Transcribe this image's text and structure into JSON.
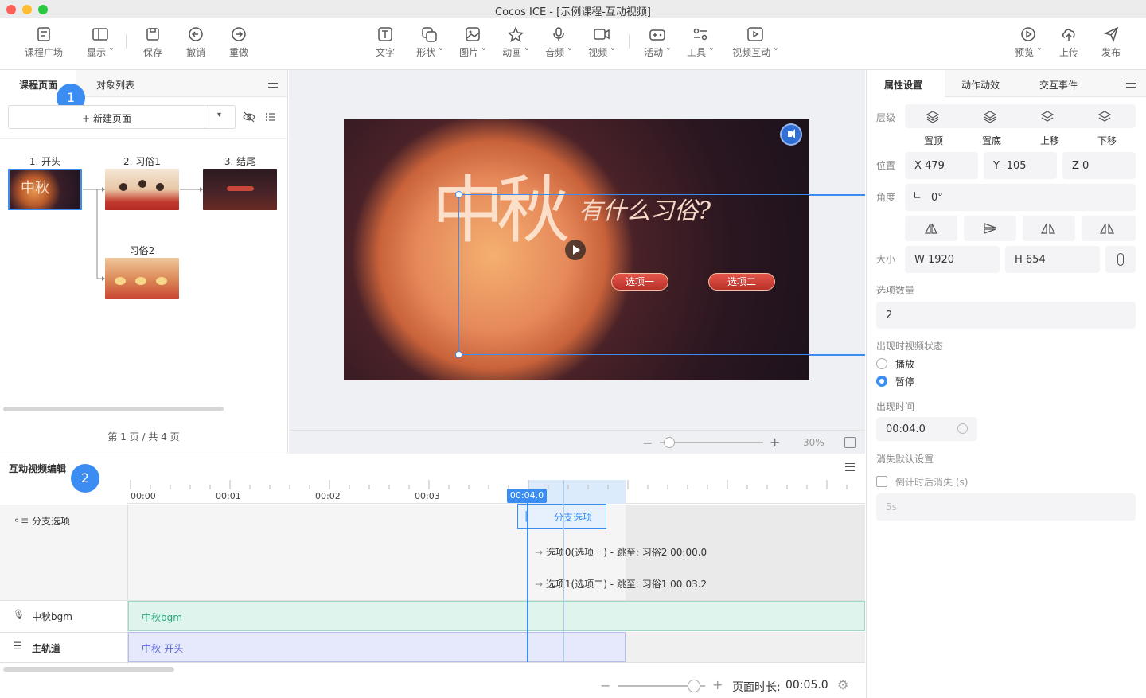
{
  "window": {
    "title": "Cocos ICE - [示例课程-互动视频]"
  },
  "toolbar": {
    "left": [
      {
        "label": "课程广场",
        "icon": "course-plaza-icon"
      },
      {
        "label": "显示",
        "icon": "display-icon"
      },
      {
        "label": "保存",
        "icon": "save-icon"
      },
      {
        "label": "撤销",
        "icon": "undo-icon"
      },
      {
        "label": "重做",
        "icon": "redo-icon"
      }
    ],
    "center": [
      {
        "label": "文字",
        "icon": "text-icon"
      },
      {
        "label": "形状",
        "icon": "shape-icon"
      },
      {
        "label": "图片",
        "icon": "image-icon"
      },
      {
        "label": "动画",
        "icon": "animation-icon"
      },
      {
        "label": "音频",
        "icon": "audio-icon"
      },
      {
        "label": "视频",
        "icon": "video-icon"
      },
      {
        "label": "活动",
        "icon": "activity-icon"
      },
      {
        "label": "工具",
        "icon": "tools-icon"
      },
      {
        "label": "视频互动",
        "icon": "video-interact-icon"
      }
    ],
    "right": [
      {
        "label": "预览",
        "icon": "preview-icon"
      },
      {
        "label": "上传",
        "icon": "upload-icon"
      },
      {
        "label": "发布",
        "icon": "publish-icon"
      }
    ]
  },
  "left_panel": {
    "tabs": [
      "课程页面",
      "对象列表"
    ],
    "new_page_label": "+ 新建页面",
    "pages": [
      {
        "title": "1. 开头"
      },
      {
        "title": "2. 习俗1"
      },
      {
        "title": "3. 结尾"
      },
      {
        "title": "习俗2"
      }
    ],
    "pager": "第 1 页 / 共 4 页",
    "badge": "1"
  },
  "canvas": {
    "heading_text": "有什么习俗?",
    "big_text": "中秋",
    "option1": "选项一",
    "option2": "选项二",
    "zoom": "30%"
  },
  "right_panel": {
    "tabs": [
      "属性设置",
      "动作动效",
      "交互事件"
    ],
    "layer_label": "层级",
    "layer_buttons": [
      "置顶",
      "置底",
      "上移",
      "下移"
    ],
    "position_label": "位置",
    "x": "X  479",
    "y": "Y  -105",
    "z": "Z  0",
    "angle_label": "角度",
    "angle": "0°",
    "size_label": "大小",
    "w": "W  1920",
    "h": "H  654",
    "option_count_label": "选项数量",
    "option_count": "2",
    "video_state_label": "出现时视频状态",
    "state_play": "播放",
    "state_pause": "暂停",
    "appear_time_label": "出现时间",
    "appear_time": "00:04.0",
    "disappear_label": "消失默认设置",
    "countdown_label": "倒计时后消失 (s)",
    "countdown_placeholder": "5s"
  },
  "timeline": {
    "title": "互动视频编辑",
    "badge": "2",
    "ticks": [
      "00:00",
      "00:01",
      "00:02",
      "00:03"
    ],
    "playhead": "00:04.0",
    "tracks": [
      {
        "label": "分支选项",
        "icon": "branch-icon"
      },
      {
        "label": "中秋bgm",
        "icon": "mic-icon"
      },
      {
        "label": "主轨道",
        "icon": "main-track-icon"
      }
    ],
    "branch_clip": "分支选项",
    "branch_items": [
      "选项0(选项一) -  跳至: 习俗2  00:00.0",
      "选项1(选项二) -  跳至: 习俗1  00:03.2"
    ],
    "bgm_clip": "中秋bgm",
    "main_clip": "中秋-开头",
    "duration_label": "页面时长:",
    "duration": "00:05.0"
  },
  "colors": {
    "accent": "#3b8df2",
    "bgm": "#e0f4ee",
    "main": "#e6e8fb"
  }
}
